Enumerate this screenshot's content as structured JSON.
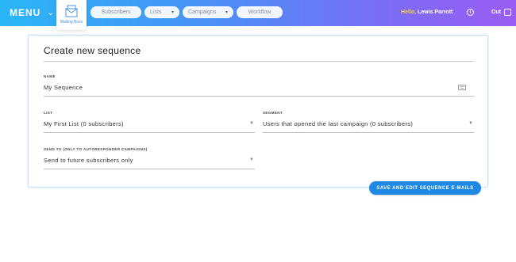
{
  "header": {
    "menu_label": "MENU",
    "logo_label": "Mailing Boss",
    "nav": {
      "subscribers": "Subscribers",
      "lists": "Lists",
      "campaigns": "Campaigns",
      "workflow": "Workflow"
    },
    "hello": "Hello,",
    "user_name": "Lewis Parrott",
    "logout": "Out"
  },
  "form": {
    "title": "Create new sequence",
    "name_label": "NAME",
    "name_value": "My Sequence",
    "list_label": "LIST",
    "list_value": "My First List (0 subscribers)",
    "segment_label": "SEGMENT",
    "segment_value": "Users that opened the last campaign (0 subscribers)",
    "send_to_label": "SEND TO (ONLY TO AUTORESPONDER CAMPAIGNS)",
    "send_to_value": "Send to future subscribers only",
    "save_button": "SAVE AND EDIT SEQUENCE E-MAILS"
  },
  "icons": {
    "logo": "envelope-icon",
    "menu": "chevron-down-icon",
    "info": "info-icon",
    "logout": "exit-icon",
    "name_field": "keyboard-icon",
    "dropdown": "caret-down-icon"
  },
  "colors": {
    "header_start": "#29b6f6",
    "header_end": "#9a5cf2",
    "accent": "#1e88e5",
    "hello": "#f2d23c"
  }
}
